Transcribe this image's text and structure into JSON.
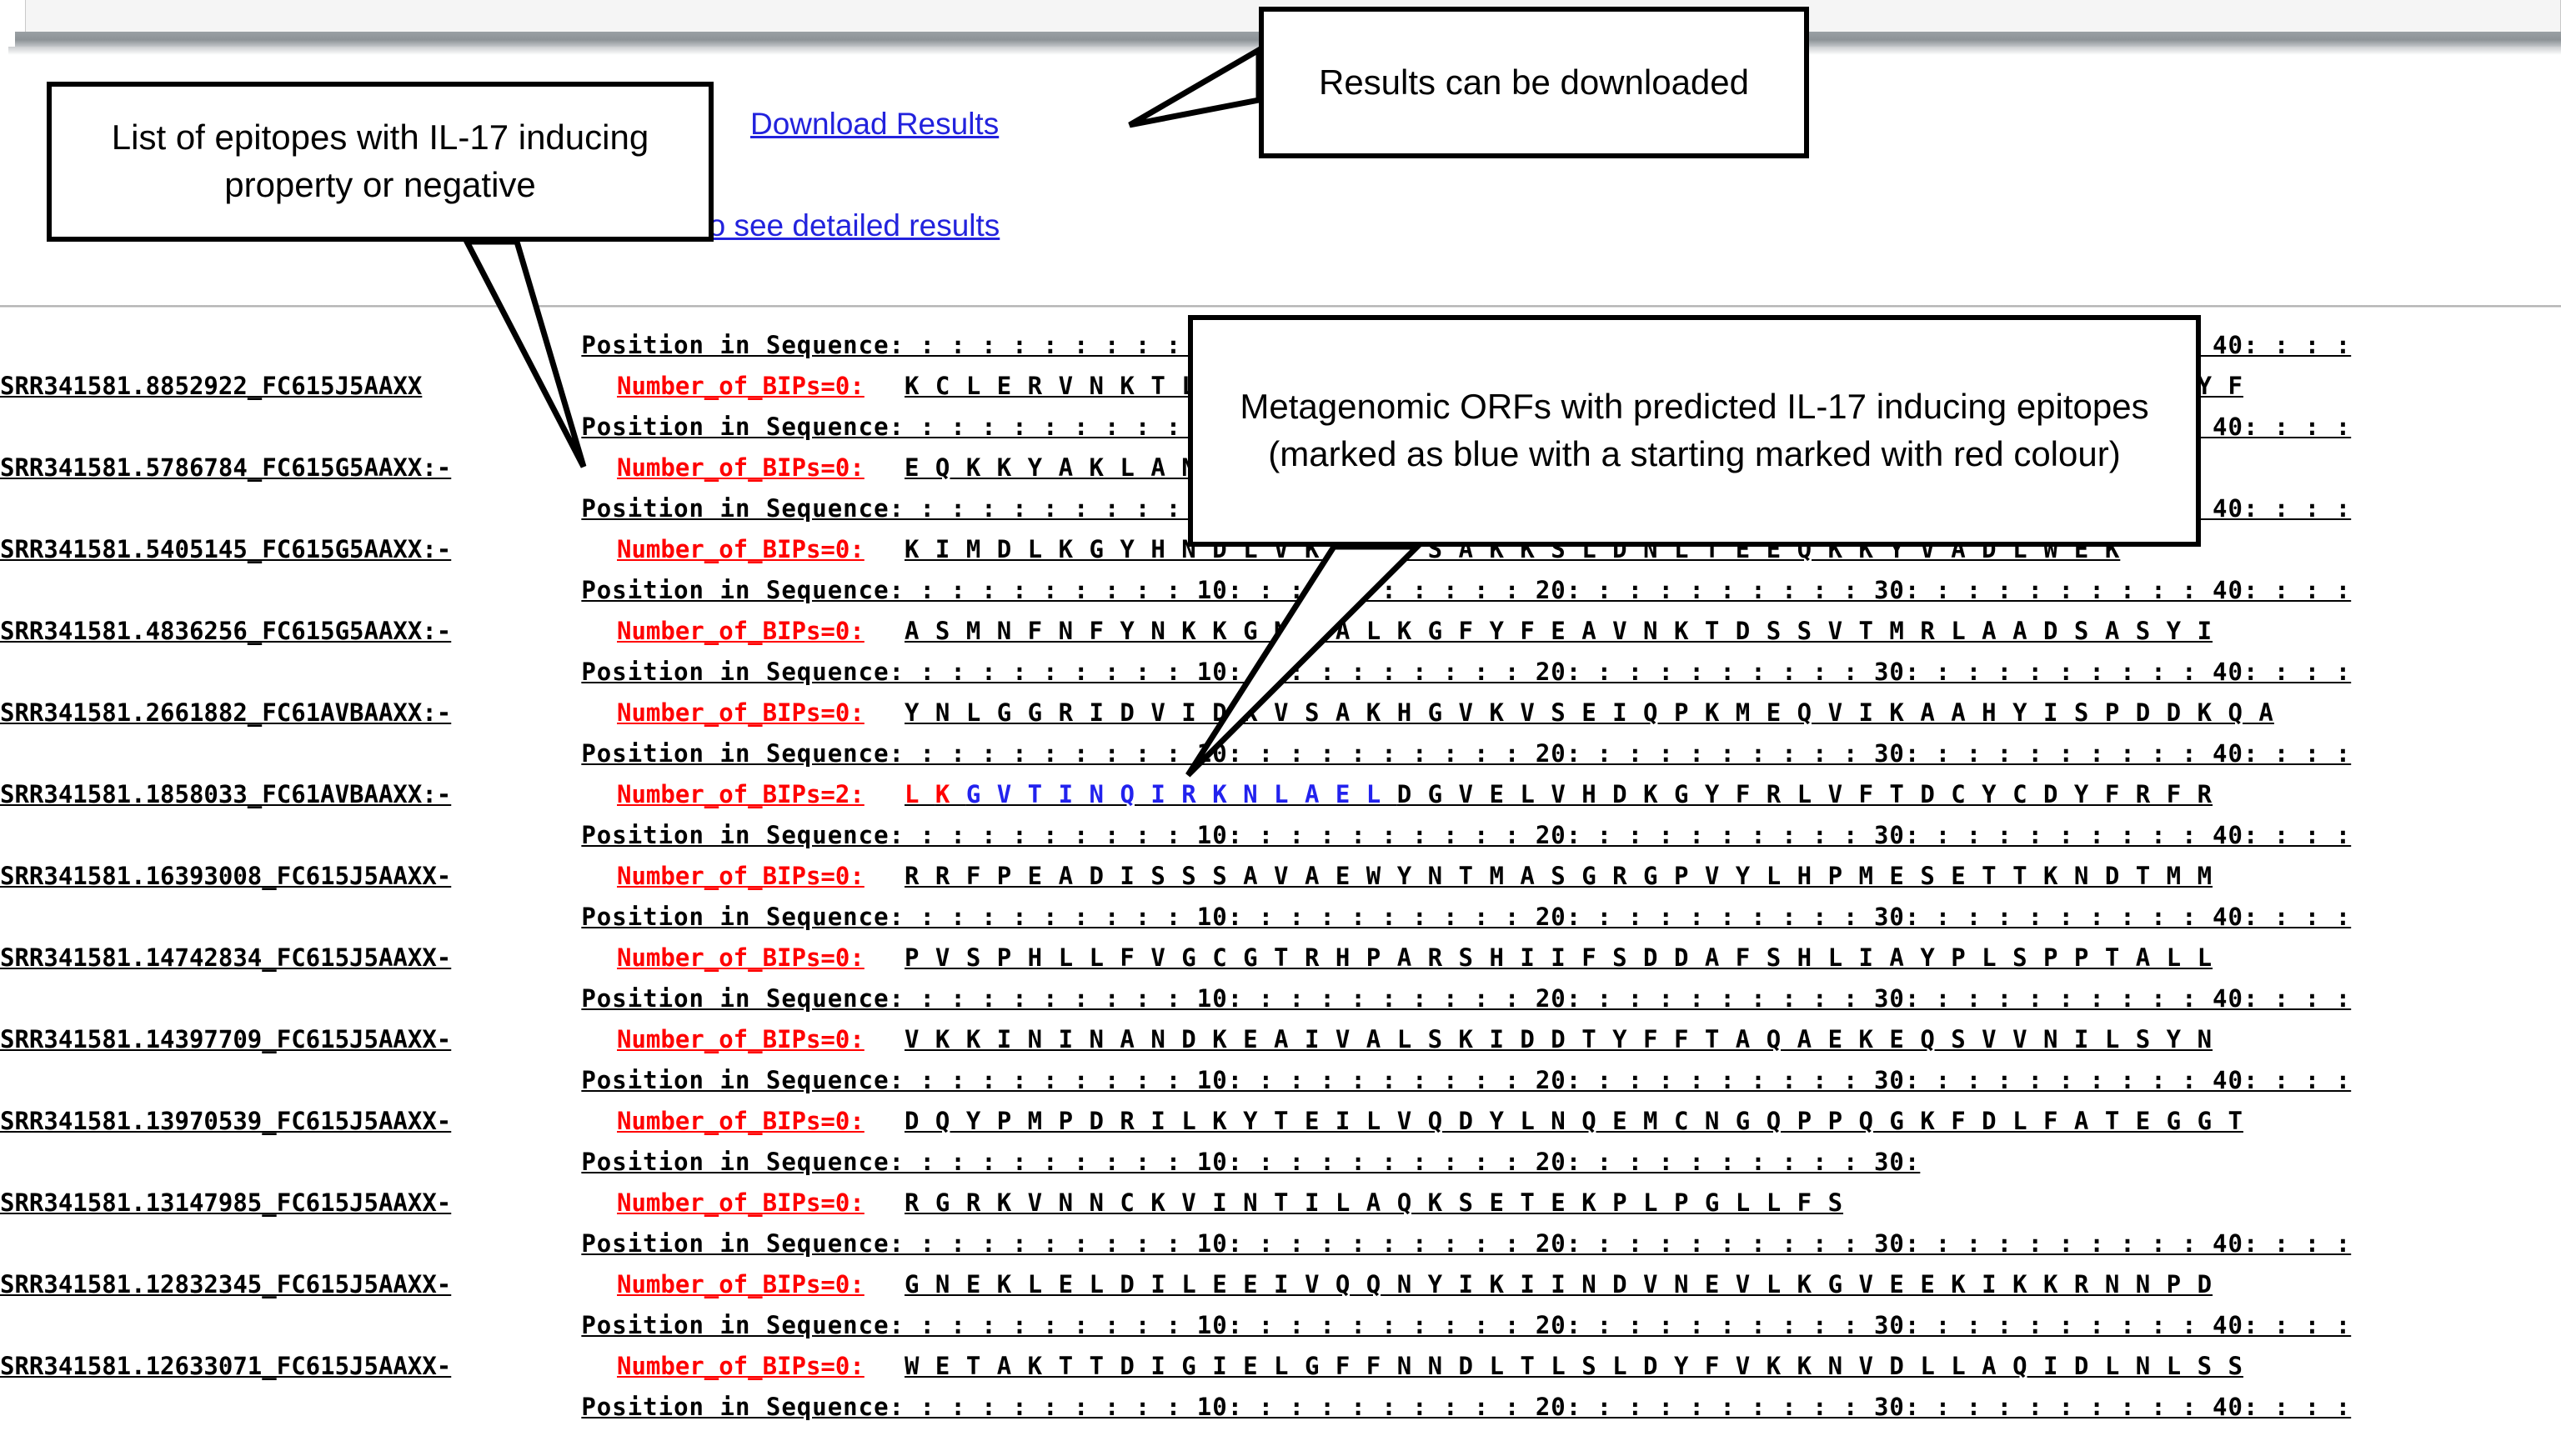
{
  "page": {
    "links": {
      "download": "Download Results",
      "detailed": "here to see detailed results"
    }
  },
  "callouts": {
    "epitopes": "List of epitopes with IL-17 inducing property or negative",
    "download": "Results can be downloaded",
    "orfs": "Metagenomic ORFs with predicted IL-17 inducing epitopes (marked as blue  with a starting marked with red colour)"
  },
  "labels": {
    "position_in_sequence": "Position in  Sequence:",
    "ruler": ":  :  :  :  :  :  :  :  :  10:  :  :  :  :  :  :  :  :  :  20:  :  :  :  :  :  :  :  :  :  30:  :  :  :  :  :  :  :  :  :  40:  :  :  :",
    "ruler_short_30": ":  :  :  :  :  :  :  :  :  10:  :  :  :  :  :  :  :  :  :  20:  :  :  :  :  :  :  :  :  :  30:"
  },
  "results": {
    "rows": [
      {
        "id": "SRR341581.8852922_FC615J5AAXX",
        "bips": "Number_of_BIPs=0:",
        "sequence": "K C L E R V N K T L E A Y K A L V K E K N L S D V L T L L E R V A L D L K K H N I  G Y F",
        "segments": [
          {
            "text": "K C L E R V N K T L E A Y K A L V K E K N L S D V L T L L E R V A L D L K K H N I  G Y F",
            "color": "black"
          }
        ]
      },
      {
        "id": "SRR341581.5786784_FC615G5AAXX:-",
        "bips": "Number_of_BIPs=0:",
        "sequence": "E Q K K Y A K L A N Q A L S K T E L N D L Q K A S D E S K I K L N A E L A R L M  M E",
        "segments": [
          {
            "text": "E Q K K Y A K L A N Q A L S K T E L N D L Q K A S D E S K I K L N A E L A R L M  M E",
            "color": "black"
          }
        ]
      },
      {
        "id": "SRR341581.5405145_FC615G5AAXX:-",
        "bips": "Number_of_BIPs=0:",
        "sequence": "K I  M D L K G Y H N D L V K A L E S A K K S L D N L T E E Q K K Y V A D L  W E K",
        "segments": [
          {
            "text": "K I  M D L K G Y H N D L V K A L E S A K K S L D N L T E E Q K K Y V A D L  W E K",
            "color": "black"
          }
        ]
      },
      {
        "id": "SRR341581.4836256_FC615G5AAXX:-",
        "bips": "Number_of_BIPs=0:",
        "sequence": "A S  M N F N F Y N K  K G N D A L K G F Y F E A V N K T D S S V T M R L A A D S A S Y I",
        "segments": [
          {
            "text": "A S  M N F N F Y N K  K G N D A L K G F Y F E A V N K T D S S V T M R L A A D S A S Y I",
            "color": "black"
          }
        ]
      },
      {
        "id": "SRR341581.2661882_FC61AVBAAXX:-",
        "bips": "Number_of_BIPs=0:",
        "sequence": "Y N L G G R I D V I  D K V S A K H G V K V S E I Q P K M E Q V I K A A H Y I S P D D K Q A",
        "segments": [
          {
            "text": "Y N L G G R I D V I  D K V S A K H G V K V S E I Q P K M E Q V I K A A H Y I S P D D K Q A",
            "color": "black"
          }
        ]
      },
      {
        "id": "SRR341581.1858033_FC61AVBAAXX:-",
        "bips": "Number_of_BIPs=2:",
        "sequence": "L K G V T I N Q I R K N L A E L D G V E L V H D K G Y F R L V F T D C Y C D Y F R F R",
        "segments": [
          {
            "text": "L ",
            "color": "red"
          },
          {
            "text": "K ",
            "color": "red"
          },
          {
            "text": "G V T I N Q I R K N L A E L ",
            "color": "blue"
          },
          {
            "text": "D G V E L V H D K G Y F R L V F T D C Y C D Y F R F R",
            "color": "black"
          }
        ]
      },
      {
        "id": "SRR341581.16393008_FC615J5AAXX-",
        "bips": "Number_of_BIPs=0:",
        "sequence": "R R F P E A D I S S S A V A E W Y N T M A S G R G P V Y L H P M E S E T T K N D T M M",
        "segments": [
          {
            "text": "R R F P E A D I S S S A V A E W Y N T M A S G R G P V Y L H P M E S E T T K N D T M M",
            "color": "black"
          }
        ]
      },
      {
        "id": "SRR341581.14742834_FC615J5AAXX-",
        "bips": "Number_of_BIPs=0:",
        "sequence": "P V S P H L L F V G C G T R H P A R S H I I F S D D A F S H L I A Y P L S P P T A L L",
        "segments": [
          {
            "text": "P V S P H L L F V G C G T R H P A R S H I I F S D D A F S H L I A Y P L S P P T A L L",
            "color": "black"
          }
        ]
      },
      {
        "id": "SRR341581.14397709_FC615J5AAXX-",
        "bips": "Number_of_BIPs=0:",
        "sequence": "V K K I N I N A N D K E A I V A L S K I D D T Y F F T A Q A E K E Q S V V N I L S Y N",
        "segments": [
          {
            "text": "V K K I N I N A N D K E A I V A L S K I D D T Y F F T A Q A E K E Q S V V N I L S Y N",
            "color": "black"
          }
        ]
      },
      {
        "id": "SRR341581.13970539_FC615J5AAXX-",
        "bips": "Number_of_BIPs=0:",
        "sequence": "D Q Y P M P D R I L K Y T E I L V Q D Y L N Q E M C N G Q P P Q G K F D L F A T E G G T",
        "segments": [
          {
            "text": "D Q Y P M P D R I L K Y T E I L V Q D Y L N Q E M C N G Q P P Q G K F D L F A T E G G T",
            "color": "black"
          }
        ]
      },
      {
        "id": "SRR341581.13147985_FC615J5AAXX-",
        "bips": "Number_of_BIPs=0:",
        "sequence": "R G R K V N N C K V I N T I L A Q K S E T E K P L P G L L F S",
        "segments": [
          {
            "text": "R G R K V N N C K V I N T I L A Q K S E T E K P L P G L L F S",
            "color": "black"
          }
        ]
      },
      {
        "id": "SRR341581.12832345_FC615J5AAXX-",
        "bips": "Number_of_BIPs=0:",
        "sequence": "G N E K L E L D I L E E I V Q Q N Y I K I I N D V N E V L K G V E E K I K K R N N P D",
        "segments": [
          {
            "text": "G N E K L E L D I L E E I V Q Q N Y I K I I N D V N E V L K G V E E K I K K R N N P D",
            "color": "black"
          }
        ]
      },
      {
        "id": "SRR341581.12633071_FC615J5AAXX-",
        "bips": "Number_of_BIPs=0:",
        "sequence": "W E T A K T T D I G I E L G F F N N D L T L S L D Y F V K K N V D L L A Q I D L N L S S",
        "segments": [
          {
            "text": "W E T A K T T D I G I E L G F F N N D L T L S L D Y F V K K N V D L L A Q I D L N L S S",
            "color": "black"
          }
        ]
      }
    ],
    "ruler_variants": [
      "full",
      "full",
      "full",
      "full",
      "full",
      "full",
      "full",
      "full",
      "full",
      "full",
      "short30",
      "full",
      "full",
      "full"
    ]
  },
  "colors": {
    "link": "#2222dd",
    "bip_red": "#ff0000",
    "epitope_blue": "#2222ee",
    "start_red": "#ff0000",
    "callout_border": "#000000",
    "hr": "#a8a8a8"
  }
}
